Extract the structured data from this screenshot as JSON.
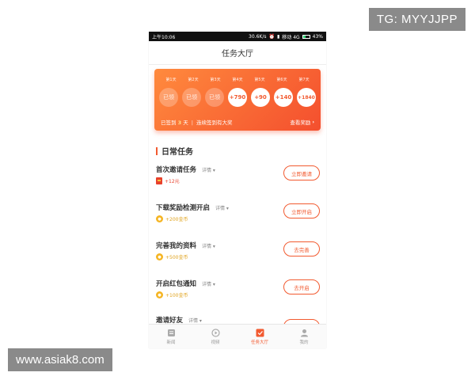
{
  "watermarks": {
    "top": "TG: MYYJJPP",
    "bottom": "www.asiak8.com"
  },
  "statusbar": {
    "time": "上午10:06",
    "speed": "30.6K/s",
    "carrier": "移动 4G",
    "battery": "43%"
  },
  "navbar": {
    "title": "任务大厅"
  },
  "checkin": {
    "days": [
      "第1天",
      "第2天",
      "第3天",
      "第4天",
      "第5天",
      "第6天",
      "第7天"
    ],
    "rewards": [
      {
        "label": "已领",
        "state": "done"
      },
      {
        "label": "已领",
        "state": "done"
      },
      {
        "label": "已领",
        "state": "done"
      },
      {
        "label": "+790",
        "state": "todo"
      },
      {
        "label": "+90",
        "state": "todo"
      },
      {
        "label": "+140",
        "state": "todo"
      },
      {
        "label": "+1840",
        "state": "todo"
      }
    ],
    "signed_prefix": "已签到",
    "signed_days": "3",
    "signed_suffix": "天",
    "separator": "|",
    "streak_text": "连续签到有大奖",
    "view_rewards": "查看奖励"
  },
  "section": {
    "title": "日常任务"
  },
  "tasks": [
    {
      "name": "首次邀请任务",
      "detail": "详情",
      "reward": "+12元",
      "reward_type": "cash",
      "button": "立即邀请"
    },
    {
      "name": "下载奖励检测开启",
      "detail": "详情",
      "reward": "+200金币",
      "reward_type": "coin",
      "button": "立即开启"
    },
    {
      "name": "完善我的资料",
      "detail": "详情",
      "reward": "+500金币",
      "reward_type": "coin",
      "button": "去完善"
    },
    {
      "name": "开启红包通知",
      "detail": "详情",
      "reward": "+100金币",
      "reward_type": "coin",
      "button": "去开启"
    },
    {
      "name": "邀请好友",
      "detail": "详情",
      "reward": "",
      "reward_type": "",
      "button": ""
    }
  ],
  "tabs": [
    {
      "label": "新闻",
      "icon": "news-icon",
      "active": false
    },
    {
      "label": "视频",
      "icon": "play-icon",
      "active": false
    },
    {
      "label": "任务大厅",
      "icon": "task-icon",
      "active": true
    },
    {
      "label": "我的",
      "icon": "user-icon",
      "active": false
    }
  ],
  "colors": {
    "accent": "#f25a30",
    "gold": "#e0a31d",
    "gradient_start": "#ff8a3d",
    "gradient_end": "#f44f2e"
  }
}
